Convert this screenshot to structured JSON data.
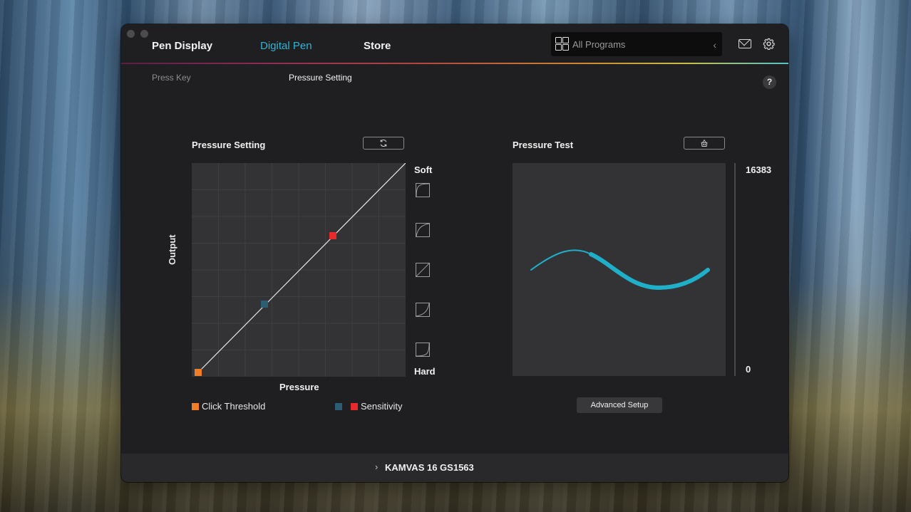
{
  "window": {
    "nav_tabs": [
      {
        "label": "Pen Display",
        "active": false
      },
      {
        "label": "Digital Pen",
        "active": true
      },
      {
        "label": "Store",
        "active": false
      }
    ],
    "program_select": {
      "value": "All Programs"
    },
    "sub_tabs": [
      {
        "label": "Press Key",
        "active": false
      },
      {
        "label": "Pressure Setting",
        "active": true
      }
    ],
    "help_label": "?"
  },
  "pressure_setting": {
    "title": "Pressure Setting",
    "reset_icon": "refresh-icon",
    "y_axis_label": "Output",
    "x_axis_label": "Pressure",
    "soft_label": "Soft",
    "hard_label": "Hard",
    "presets": [
      "soft-curve-1",
      "soft-curve-2",
      "linear",
      "hard-curve-1",
      "hard-curve-2"
    ],
    "curve": {
      "click_threshold": [
        0.03,
        0.02
      ],
      "mid_point": [
        0.34,
        0.34
      ],
      "sensitivity": [
        0.66,
        0.66
      ]
    },
    "legend": {
      "click_threshold": "Click Threshold",
      "sensitivity": "Sensitivity"
    },
    "colors": {
      "click_threshold": "#f07e26",
      "mid_point": "#2b5e73",
      "sensitivity": "#e82a2a",
      "accent": "#29b6d4"
    }
  },
  "pressure_test": {
    "title": "Pressure Test",
    "clear_icon": "eraser-icon",
    "max_value": "16383",
    "min_value": "0",
    "advanced_button": "Advanced Setup",
    "stroke_color": "#1fb0c9"
  },
  "footer": {
    "device": "KAMVAS 16 GS1563"
  }
}
